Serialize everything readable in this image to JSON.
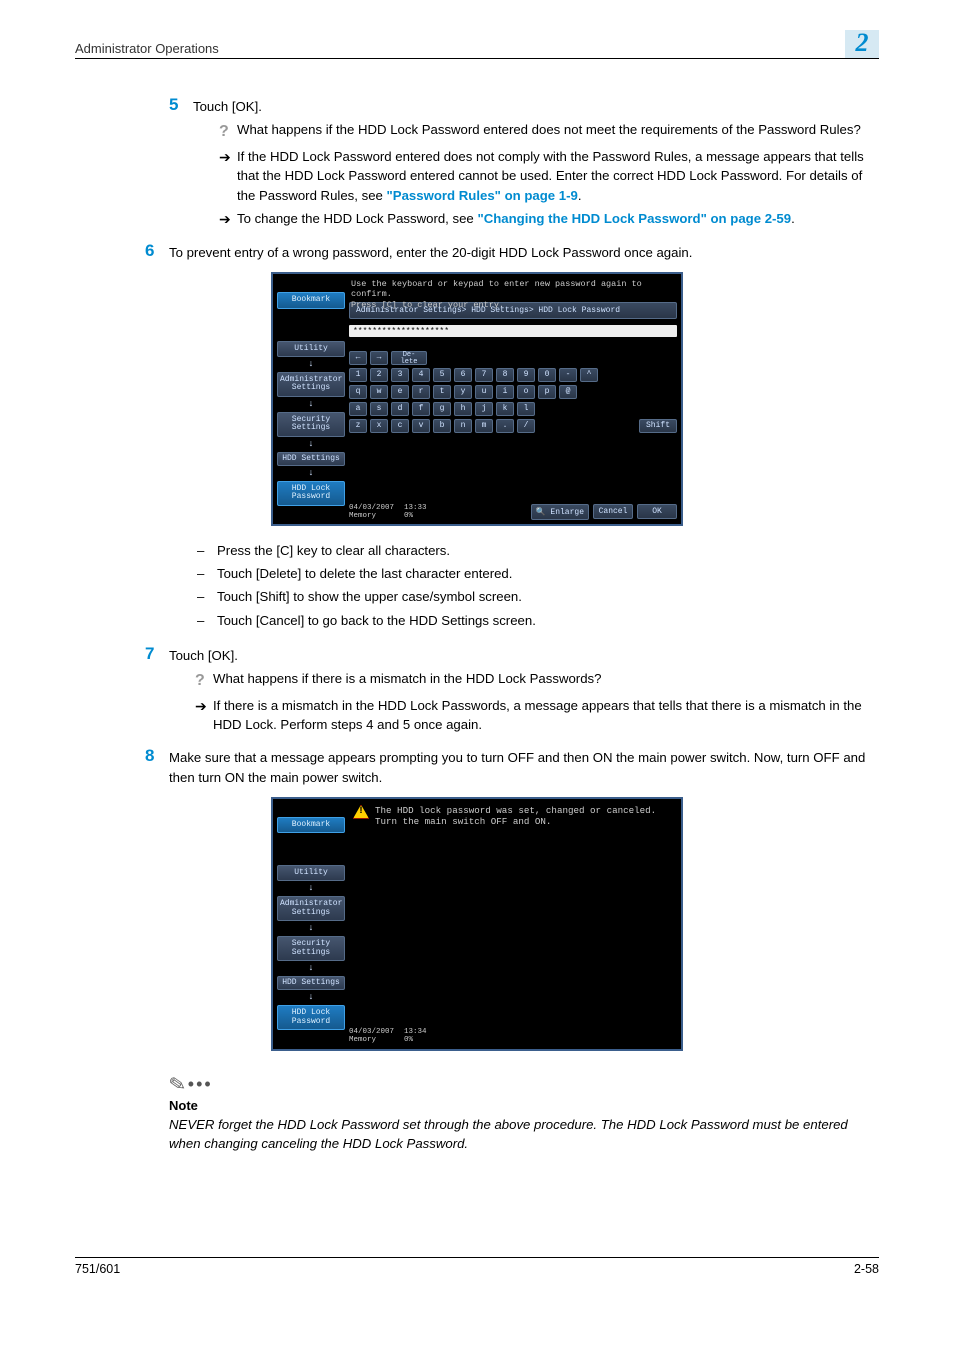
{
  "header": {
    "title": "Administrator Operations",
    "chapter": "2"
  },
  "footer": {
    "model": "751/601",
    "page": "2-58"
  },
  "step5": {
    "num": "5",
    "text": "Touch [OK].",
    "q": "What happens if the HDD Lock Password entered does not meet the requirements of the Password Rules?",
    "a1_pre": "If the HDD Lock Password entered does not comply with the Password Rules, a message appears that tells that the HDD Lock Password entered cannot be used. Enter the correct HDD Lock Password. For details of the Password Rules, see ",
    "a1_link": "\"Password Rules\" on page 1-9",
    "a1_post": ".",
    "a2_pre": "To change the HDD Lock Password, see ",
    "a2_link": "\"Changing the HDD Lock Password\" on page 2-59",
    "a2_post": "."
  },
  "step6": {
    "num": "6",
    "text": "To prevent entry of a wrong password, enter the 20-digit HDD Lock Password once again.",
    "dashes": [
      "Press the [C] key to clear all characters.",
      "Touch [Delete] to delete the last character entered.",
      "Touch [Shift] to show the upper case/symbol screen.",
      "Touch [Cancel] to go back to the HDD Settings screen."
    ]
  },
  "step7": {
    "num": "7",
    "text": "Touch [OK].",
    "q": "What happens if there is a mismatch in the HDD Lock Passwords?",
    "a": "If there is a mismatch in the HDD Lock Passwords, a message appears that tells that there is a mismatch in the HDD Lock. Perform steps 4 and 5 once again."
  },
  "step8": {
    "num": "8",
    "text": "Make sure that a message appears prompting you to turn OFF and then ON the main power switch. Now, turn OFF and then turn ON the main power switch."
  },
  "note": {
    "label": "Note",
    "text": "NEVER forget the HDD Lock Password set through the above procedure. The HDD Lock Password must be entered when changing canceling the HDD Lock Password."
  },
  "screen1": {
    "msg1": "Use the keyboard or keypad to enter new password again to confirm.",
    "msg2": "Press [C] to clear your entry.",
    "crumb": "Administrator Settings> HDD Settings> HDD Lock Password",
    "input": "********************",
    "delete_label": "De-\nlete",
    "keys_row1": [
      "1",
      "2",
      "3",
      "4",
      "5",
      "6",
      "7",
      "8",
      "9",
      "0",
      "-",
      "^"
    ],
    "keys_row2": [
      "q",
      "w",
      "e",
      "r",
      "t",
      "y",
      "u",
      "i",
      "o",
      "p",
      "@"
    ],
    "keys_row3": [
      "a",
      "s",
      "d",
      "f",
      "g",
      "h",
      "j",
      "k",
      "l"
    ],
    "keys_row4": [
      "z",
      "x",
      "c",
      "v",
      "b",
      "n",
      "m",
      ".",
      "/"
    ],
    "shift": "Shift",
    "side": {
      "bookmark": "Bookmark",
      "utility": "Utility",
      "admin": "Administrator\nSettings",
      "security": "Security\nSettings",
      "hdd": "HDD Settings",
      "lock": "HDD Lock\nPassword"
    },
    "date": "04/03/2007",
    "time": "13:33",
    "memory_label": "Memory",
    "memory_pct": "0%",
    "enlarge": "Enlarge",
    "cancel": "Cancel",
    "ok": "OK"
  },
  "screen2": {
    "warn1": "The HDD lock password was set, changed or canceled.",
    "warn2": "Turn the main switch OFF and ON.",
    "side": {
      "bookmark": "Bookmark",
      "utility": "Utility",
      "admin": "Administrator\nSettings",
      "security": "Security\nSettings",
      "hdd": "HDD Settings",
      "lock": "HDD Lock\nPassword"
    },
    "date": "04/03/2007",
    "time": "13:34",
    "memory_label": "Memory",
    "memory_pct": "0%"
  }
}
